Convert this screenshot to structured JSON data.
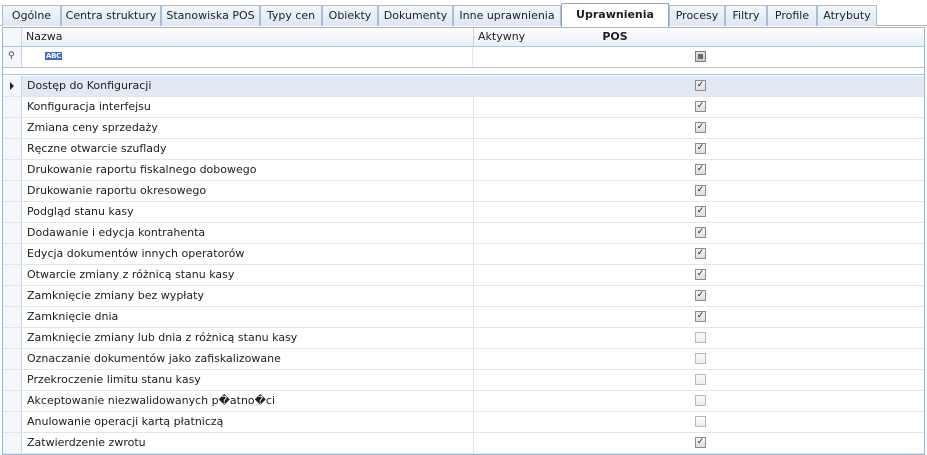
{
  "tabs": [
    {
      "label": "Ogólne",
      "active": false
    },
    {
      "label": "Centra struktury",
      "active": false
    },
    {
      "label": "Stanowiska POS",
      "active": false
    },
    {
      "label": "Typy cen",
      "active": false
    },
    {
      "label": "Obiekty",
      "active": false
    },
    {
      "label": "Dokumenty",
      "active": false
    },
    {
      "label": "Inne uprawnienia",
      "active": false
    },
    {
      "label": "Uprawnienia POS",
      "active": true
    },
    {
      "label": "Procesy",
      "active": false
    },
    {
      "label": "Filtry",
      "active": false
    },
    {
      "label": "Profile",
      "active": false
    },
    {
      "label": "Atrybuty",
      "active": false
    }
  ],
  "grid": {
    "columns": [
      {
        "label": "Nazwa"
      },
      {
        "label": "Aktywny"
      }
    ],
    "filter": {
      "text_icon": "abc-filter-icon",
      "abc_label": "ABC",
      "active_checkbox_state": "indeterminate"
    },
    "rows": [
      {
        "name": "Dostęp do Konfiguracji",
        "active": true
      },
      {
        "name": "Konfiguracja interfejsu",
        "active": true
      },
      {
        "name": "Zmiana ceny sprzedaży",
        "active": true
      },
      {
        "name": "Ręczne otwarcie szuflady",
        "active": true
      },
      {
        "name": "Drukowanie raportu fiskalnego dobowego",
        "active": true
      },
      {
        "name": "Drukowanie raportu okresowego",
        "active": true
      },
      {
        "name": "Podgląd stanu kasy",
        "active": true
      },
      {
        "name": "Dodawanie i edycja kontrahenta",
        "active": true
      },
      {
        "name": "Edycja dokumentów innych operatorów",
        "active": true
      },
      {
        "name": "Otwarcie zmiany z różnicą stanu kasy",
        "active": true
      },
      {
        "name": "Zamknięcie zmiany bez wypłaty",
        "active": true
      },
      {
        "name": "Zamknięcie dnia",
        "active": true
      },
      {
        "name": "Zamknięcie zmiany lub dnia z różnicą stanu kasy",
        "active": false
      },
      {
        "name": "Oznaczanie dokumentów jako zafiskalizowane",
        "active": false
      },
      {
        "name": "Przekroczenie limitu stanu kasy",
        "active": false
      },
      {
        "name": "Akceptowanie niezwalidowanych p�atno�ci",
        "active": false
      },
      {
        "name": "Anulowanie operacji kartą płatniczą",
        "active": false
      },
      {
        "name": "Zatwierdzenie zwrotu",
        "active": true
      }
    ],
    "check_glyph": "✓"
  },
  "colors": {
    "accent": "#9fb6d3",
    "selected_row": "#e1e9f4"
  }
}
